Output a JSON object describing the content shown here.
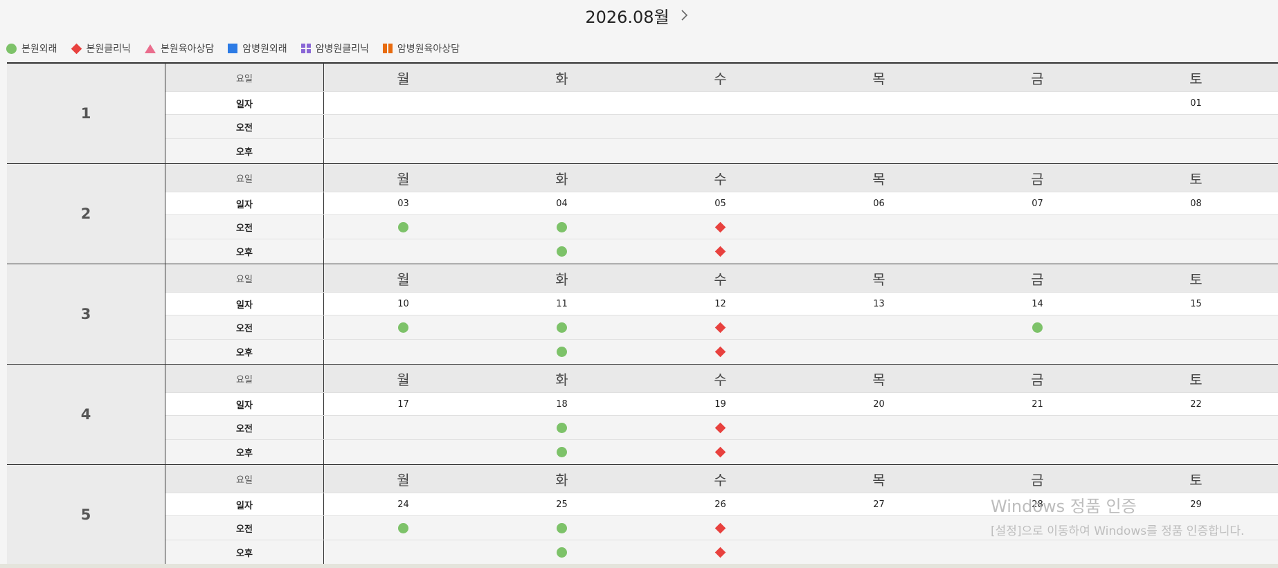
{
  "header": {
    "month_title": "2026.08월",
    "next_icon": "chevron-right-icon"
  },
  "legend": [
    {
      "label": "본원외래",
      "icon": "green-circle-icon",
      "color": "#7dc269"
    },
    {
      "label": "본원클리닉",
      "icon": "red-diamond-icon",
      "color": "#e8413e"
    },
    {
      "label": "본원육아상담",
      "icon": "pink-triangle-icon",
      "color": "#ea6d8d"
    },
    {
      "label": "암병원외래",
      "icon": "blue-square-icon",
      "color": "#2c7be5"
    },
    {
      "label": "암병원클리닉",
      "icon": "purple-grid-icon",
      "color": "#8966d6"
    },
    {
      "label": "암병원육아상담",
      "icon": "orange-bars-icon",
      "color": "#e86b0f"
    }
  ],
  "row_labels": {
    "dow": "요일",
    "date": "일자",
    "am": "오전",
    "pm": "오후"
  },
  "weekdays": [
    "월",
    "화",
    "수",
    "목",
    "금",
    "토"
  ],
  "weeks": [
    {
      "num": "1",
      "dates": [
        "",
        "",
        "",
        "",
        "",
        "01"
      ],
      "am": [
        "",
        "",
        "",
        "",
        "",
        ""
      ],
      "pm": [
        "",
        "",
        "",
        "",
        "",
        ""
      ]
    },
    {
      "num": "2",
      "dates": [
        "03",
        "04",
        "05",
        "06",
        "07",
        "08"
      ],
      "am": [
        "circle",
        "circle",
        "diamond",
        "",
        "",
        ""
      ],
      "pm": [
        "",
        "circle",
        "diamond",
        "",
        "",
        ""
      ]
    },
    {
      "num": "3",
      "dates": [
        "10",
        "11",
        "12",
        "13",
        "14",
        "15"
      ],
      "am": [
        "circle",
        "circle",
        "diamond",
        "",
        "circle",
        ""
      ],
      "pm": [
        "",
        "circle",
        "diamond",
        "",
        "",
        ""
      ]
    },
    {
      "num": "4",
      "dates": [
        "17",
        "18",
        "19",
        "20",
        "21",
        "22"
      ],
      "am": [
        "",
        "circle",
        "diamond",
        "",
        "",
        ""
      ],
      "pm": [
        "",
        "circle",
        "diamond",
        "",
        "",
        ""
      ]
    },
    {
      "num": "5",
      "dates": [
        "24",
        "25",
        "26",
        "27",
        "28",
        "29"
      ],
      "am": [
        "circle",
        "circle",
        "diamond",
        "",
        "",
        ""
      ],
      "pm": [
        "",
        "circle",
        "diamond",
        "",
        "",
        ""
      ]
    }
  ],
  "watermark": {
    "title": "Windows 정품 인증",
    "subtitle": "[설정]으로 이동하여 Windows를 정품 인증합니다."
  }
}
